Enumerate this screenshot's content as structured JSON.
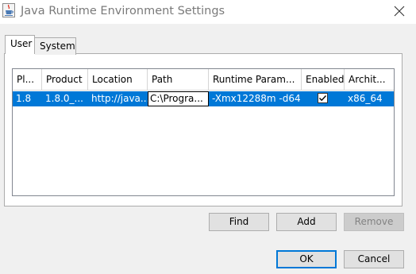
{
  "window": {
    "title": "Java Runtime Environment Settings",
    "icon": "java-cup-icon",
    "close_icon": "close-icon"
  },
  "tabs": [
    {
      "label": "User",
      "selected": true
    },
    {
      "label": "System",
      "selected": false
    }
  ],
  "table": {
    "columns": [
      "Pl...",
      "Product",
      "Location",
      "Path",
      "Runtime Param...",
      "Enabled",
      "Archit..."
    ],
    "rows": [
      {
        "platform": "1.8",
        "product": "1.8.0_...",
        "location": "http://java....",
        "path": "C:\\Progra...",
        "runtime_params": "-Xmx12288m -d64",
        "enabled": true,
        "architecture": "x86_64"
      }
    ]
  },
  "buttons": {
    "find": "Find",
    "add": "Add",
    "remove": "Remove",
    "ok": "OK",
    "cancel": "Cancel"
  },
  "colors": {
    "selection": "#0078d7",
    "dialog_bg": "#f0f0f0",
    "disabled_text": "#838383"
  }
}
